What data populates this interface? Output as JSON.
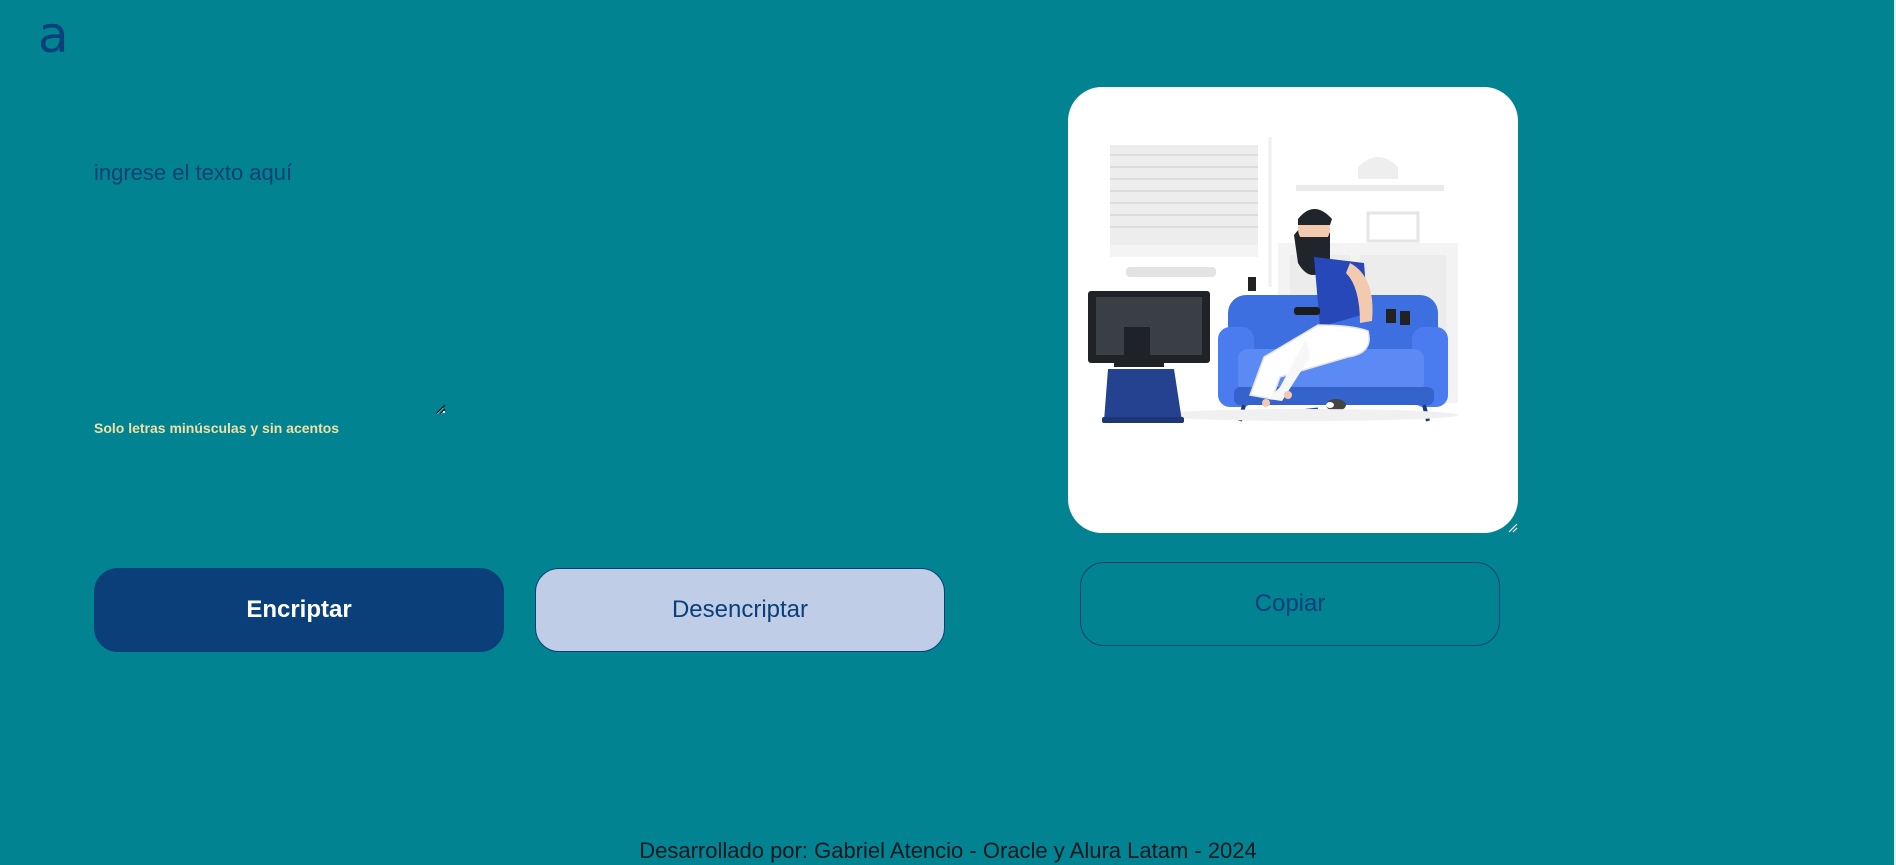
{
  "header": {
    "logo_text": "a",
    "logo_icon": "alura-logo-icon"
  },
  "input": {
    "placeholder": "ingrese el texto aquí",
    "value": ""
  },
  "hint": {
    "text": "Solo letras minúsculas y sin acentos"
  },
  "actions": {
    "encrypt_label": "Encriptar",
    "decrypt_label": "Desencriptar"
  },
  "output": {
    "illustration": "person-gaming-on-couch-illustration",
    "copy_label": "Copiar"
  },
  "footer": {
    "text": "Desarrollado por: Gabriel Atencio - Oracle y Alura Latam - 2024"
  },
  "colors": {
    "background": "#028391",
    "primary": "#0a3f7a",
    "secondary": "#bfcde6",
    "hint": "#f1dfa6"
  }
}
